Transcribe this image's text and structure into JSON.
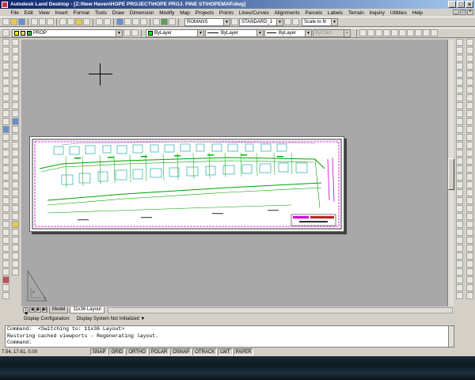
{
  "window": {
    "title": "Autodesk Land Desktop - [Z:\\New Haven\\HOPE PROJECT\\HOPE PROJ. PINE ST\\HOPEMAP.dwg]"
  },
  "menu": [
    "File",
    "Edit",
    "View",
    "Insert",
    "Format",
    "Tools",
    "Draw",
    "Dimension",
    "Modify",
    "Map",
    "Projects",
    "Points",
    "Lines/Curves",
    "Alignments",
    "Parcels",
    "Labels",
    "Terrain",
    "Inquiry",
    "Utilities",
    "Help"
  ],
  "toolbar": {
    "text_style": "ROMANS",
    "dim_style": "STANDARD_1",
    "zoom": "Scale to fit",
    "layer": "PROP",
    "color": "ByLayer",
    "linetype": "ByLayer",
    "lineweight": "ByLayer",
    "plotstyle": "ByColor"
  },
  "layout_tabs": [
    "Model",
    "11x36 Layout"
  ],
  "active_tab": "11x36 Layout",
  "display": {
    "label": "Display Configuration:",
    "value": "Display System Not Initialized"
  },
  "command_lines": [
    "Command:  <Switching to: 11x36 Layout>",
    "Restoring cached viewports - Regenerating layout.",
    "Command:"
  ],
  "status": {
    "coords": "7.54,  17.61,  0.00",
    "toggles": [
      "SNAP",
      "GRID",
      "ORTHO",
      "POLAR",
      "OSNAP",
      "OTRACK",
      "LWT",
      "PAPER"
    ]
  },
  "colors": {
    "titlebar": "#0a246a",
    "canvas": "#a8a8a8",
    "linework": "#00a000",
    "frame": "#d000d0"
  }
}
